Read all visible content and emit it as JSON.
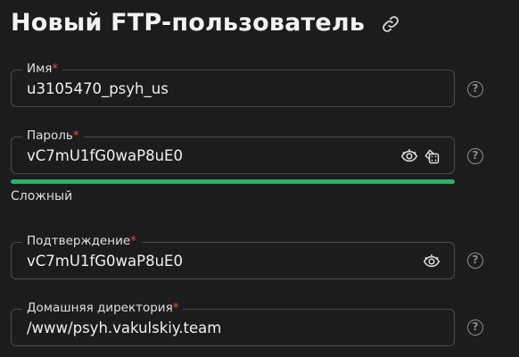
{
  "header": {
    "title": "Новый FTP-пользователь",
    "link_icon": "link-icon"
  },
  "fields": {
    "name": {
      "label": "Имя",
      "required_mark": "*",
      "value": "u3105470_psyh_us"
    },
    "password": {
      "label": "Пароль",
      "required_mark": "*",
      "value": "vC7mU1fG0waP8uE0"
    },
    "confirm": {
      "label": "Подтверждение",
      "required_mark": "*",
      "value": "vC7mU1fG0waP8uE0"
    },
    "home": {
      "label": "Домашняя директория",
      "required_mark": "*",
      "value": "/www/psyh.vakulskiy.team"
    }
  },
  "password_strength": {
    "label": "Сложный",
    "level": 1.0,
    "color": "#28b463"
  },
  "help_glyph": "?",
  "colors": {
    "required": "#e5484d",
    "background": "#1c1c1e"
  }
}
